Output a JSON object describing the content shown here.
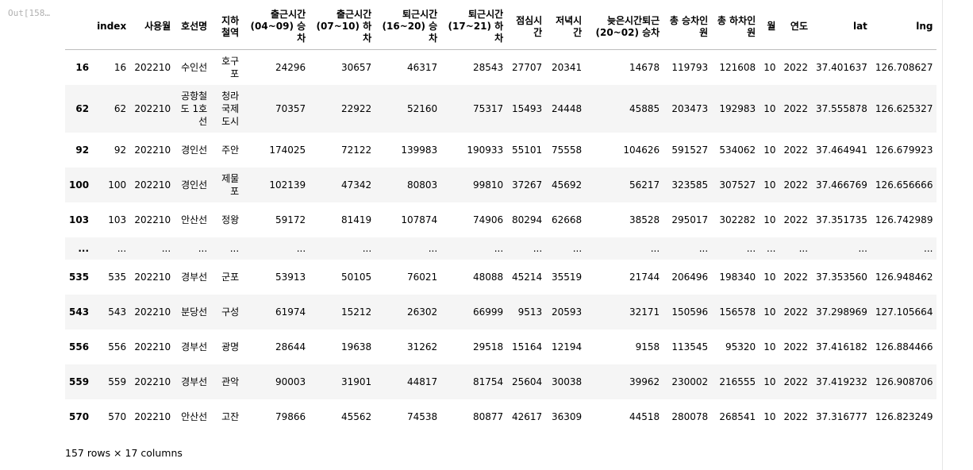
{
  "cell": {
    "prompt": "Out[158…"
  },
  "table": {
    "headers": [
      "index",
      "사용월",
      "호선명",
      "지하철역",
      "출근시간(04~09) 승차",
      "출근시간(07~10) 하차",
      "퇴근시간(16~20) 승차",
      "퇴근시간(17~21) 하차",
      "점심시간",
      "저녁시간",
      "늦은시간퇴근(20~02) 승차",
      "총 승차인원",
      "총 하차인원",
      "월",
      "연도",
      "lat",
      "lng"
    ],
    "rows": [
      {
        "idx": "16",
        "cells": [
          "16",
          "202210",
          "수인선",
          "호구포",
          "24296",
          "30657",
          "46317",
          "28543",
          "27707",
          "20341",
          "14678",
          "119793",
          "121608",
          "10",
          "2022",
          "37.401637",
          "126.708627"
        ]
      },
      {
        "idx": "62",
        "cells": [
          "62",
          "202210",
          "공항철도 1호선",
          "청라국제도시",
          "70357",
          "22922",
          "52160",
          "75317",
          "15493",
          "24448",
          "45885",
          "203473",
          "192983",
          "10",
          "2022",
          "37.555878",
          "126.625327"
        ]
      },
      {
        "idx": "92",
        "cells": [
          "92",
          "202210",
          "경인선",
          "주안",
          "174025",
          "72122",
          "139983",
          "190933",
          "55101",
          "75558",
          "104626",
          "591527",
          "534062",
          "10",
          "2022",
          "37.464941",
          "126.679923"
        ]
      },
      {
        "idx": "100",
        "cells": [
          "100",
          "202210",
          "경인선",
          "제물포",
          "102139",
          "47342",
          "80803",
          "99810",
          "37267",
          "45692",
          "56217",
          "323585",
          "307527",
          "10",
          "2022",
          "37.466769",
          "126.656666"
        ]
      },
      {
        "idx": "103",
        "cells": [
          "103",
          "202210",
          "안산선",
          "정왕",
          "59172",
          "81419",
          "107874",
          "74906",
          "80294",
          "62668",
          "38528",
          "295017",
          "302282",
          "10",
          "2022",
          "37.351735",
          "126.742989"
        ]
      },
      {
        "idx": "...",
        "cells": [
          "...",
          "...",
          "...",
          "...",
          "...",
          "...",
          "...",
          "...",
          "...",
          "...",
          "...",
          "...",
          "...",
          "...",
          "...",
          "...",
          "..."
        ]
      },
      {
        "idx": "535",
        "cells": [
          "535",
          "202210",
          "경부선",
          "군포",
          "53913",
          "50105",
          "76021",
          "48088",
          "45214",
          "35519",
          "21744",
          "206496",
          "198340",
          "10",
          "2022",
          "37.353560",
          "126.948462"
        ]
      },
      {
        "idx": "543",
        "cells": [
          "543",
          "202210",
          "분당선",
          "구성",
          "61974",
          "15212",
          "26302",
          "66999",
          "9513",
          "20593",
          "32171",
          "150596",
          "156578",
          "10",
          "2022",
          "37.298969",
          "127.105664"
        ]
      },
      {
        "idx": "556",
        "cells": [
          "556",
          "202210",
          "경부선",
          "광명",
          "28644",
          "19638",
          "31262",
          "29518",
          "15164",
          "12194",
          "9158",
          "113545",
          "95320",
          "10",
          "2022",
          "37.416182",
          "126.884466"
        ]
      },
      {
        "idx": "559",
        "cells": [
          "559",
          "202210",
          "경부선",
          "관악",
          "90003",
          "31901",
          "44817",
          "81754",
          "25604",
          "30038",
          "39962",
          "230002",
          "216555",
          "10",
          "2022",
          "37.419232",
          "126.908706"
        ]
      },
      {
        "idx": "570",
        "cells": [
          "570",
          "202210",
          "안산선",
          "고잔",
          "79866",
          "45562",
          "74538",
          "80877",
          "42617",
          "36309",
          "44518",
          "280078",
          "268541",
          "10",
          "2022",
          "37.316777",
          "126.823249"
        ]
      }
    ]
  },
  "footer": {
    "shape": "157 rows × 17 columns"
  }
}
